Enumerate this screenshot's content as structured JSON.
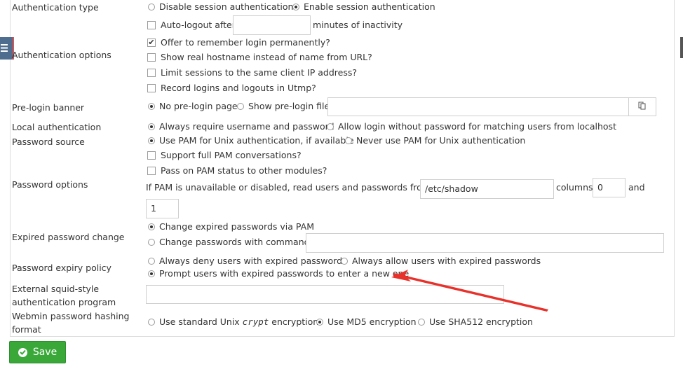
{
  "labels": {
    "auth_type": "Authentication type",
    "auth_options": "Authentication options",
    "prelogin_banner": "Pre-login banner",
    "local_auth": "Local authentication",
    "password_source": "Password source",
    "password_options": "Password options",
    "expired_change": "Expired password change",
    "expiry_policy": "Password expiry policy",
    "external_squid_1": "External squid-style",
    "external_squid_2": "authentication program",
    "hashing_1": "Webmin password hashing",
    "hashing_2": "format"
  },
  "auth_type": {
    "disable": "Disable session authentication",
    "enable": "Enable session authentication",
    "selected": "enable"
  },
  "auth_options": {
    "autologout_label": "Auto-logout after",
    "autologout_value": "",
    "autologout_suffix": "minutes of inactivity",
    "autologout_checked": false,
    "remember": "Offer to remember login permanently?",
    "remember_checked": true,
    "real_hostname": "Show real hostname instead of name from URL?",
    "real_hostname_checked": false,
    "limit_ip": "Limit sessions to the same client IP address?",
    "limit_ip_checked": false,
    "record_utmp": "Record logins and logouts in Utmp?",
    "record_utmp_checked": false
  },
  "prelogin": {
    "no_page": "No pre-login page",
    "show_file": "Show pre-login file",
    "file_value": "",
    "selected": "no_page"
  },
  "local_auth": {
    "always": "Always require username and password",
    "allow_local": "Allow login without password for matching users from localhost",
    "selected": "always"
  },
  "password_source": {
    "use_pam": "Use PAM for Unix authentication, if available",
    "never_pam": "Never use PAM for Unix authentication",
    "selected": "use_pam",
    "full_pam": "Support full PAM conversations?",
    "full_pam_checked": false,
    "pass_status": "Pass on PAM status to other modules?",
    "pass_status_checked": false
  },
  "password_options": {
    "prefix": "If PAM is unavailable or disabled, read users and passwords from file",
    "file": "/etc/shadow",
    "columns_label": "columns",
    "columns_value": "0",
    "and_label": "and",
    "second_value": "1"
  },
  "expired_change": {
    "via_pam": "Change expired passwords via PAM",
    "with_command": "Change passwords with command:",
    "command_value": "",
    "selected": "via_pam"
  },
  "expiry_policy": {
    "deny": "Always deny users with expired passwords",
    "allow": "Always allow users with expired passwords",
    "prompt": "Prompt users with expired passwords to enter a new one",
    "selected": "prompt"
  },
  "external_squid": {
    "value": ""
  },
  "hashing": {
    "std_prefix": "Use standard Unix",
    "std_code": "crypt",
    "std_suffix": "encryption",
    "md5": "Use MD5 encryption",
    "sha512": "Use SHA512 encryption",
    "selected": "md5"
  },
  "save_label": "Save",
  "colors": {
    "save_green": "#39a839",
    "arrow_red": "#e8312a",
    "sidebar_toggle": "#4f6d8f"
  },
  "icons": {
    "menu": "hamburger-menu-icon",
    "save": "check-circle-icon",
    "file_chooser": "file-chooser-icon"
  }
}
